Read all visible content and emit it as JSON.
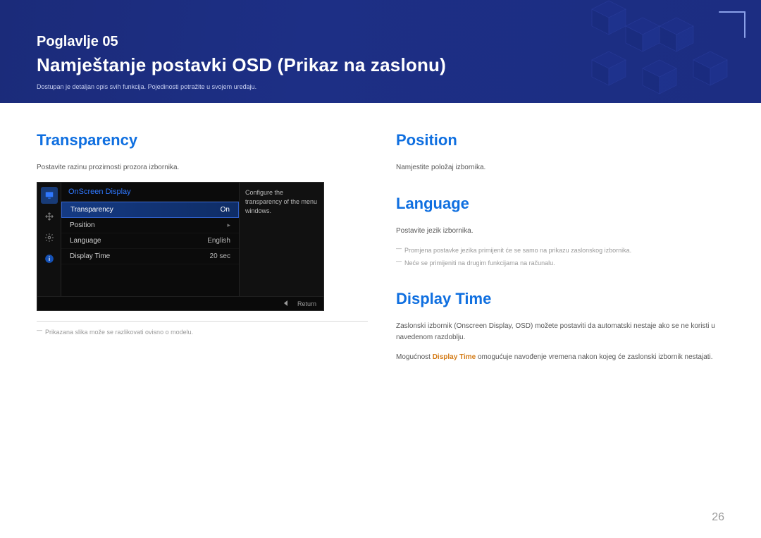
{
  "header": {
    "chapter": "Poglavlje 05",
    "title": "Namještanje postavki OSD (Prikaz na zaslonu)",
    "sub": "Dostupan je detaljan opis svih funkcija. Pojedinosti potražite u svojem uređaju."
  },
  "transparency": {
    "heading": "Transparency",
    "body": "Postavite razinu prozirnosti prozora izbornika.",
    "footnote": "Prikazana slika može se razlikovati ovisno o modelu."
  },
  "osd": {
    "title": "OnScreen Display",
    "rows": [
      {
        "label": "Transparency",
        "value": "On",
        "selected": true
      },
      {
        "label": "Position",
        "value": "",
        "arrow": true
      },
      {
        "label": "Language",
        "value": "English"
      },
      {
        "label": "Display Time",
        "value": "20 sec"
      }
    ],
    "help": "Configure the transparency of the menu windows.",
    "return": "Return"
  },
  "position": {
    "heading": "Position",
    "body": "Namjestite položaj izbornika."
  },
  "language": {
    "heading": "Language",
    "body": "Postavite jezik izbornika.",
    "note1": "Promjena postavke jezika primijenit će se samo na prikazu zaslonskog izbornika.",
    "note2": "Neće se primijeniti na drugim funkcijama na računalu."
  },
  "displayTime": {
    "heading": "Display Time",
    "body1": "Zaslonski izbornik (Onscreen Display, OSD) možete postaviti da automatski nestaje ako se ne koristi u navedenom razdoblju.",
    "body2_prefix": "Mogućnost ",
    "body2_emph": "Display Time",
    "body2_suffix": " omogućuje navođenje vremena nakon kojeg će zaslonski izbornik nestajati."
  },
  "pageNumber": "26"
}
